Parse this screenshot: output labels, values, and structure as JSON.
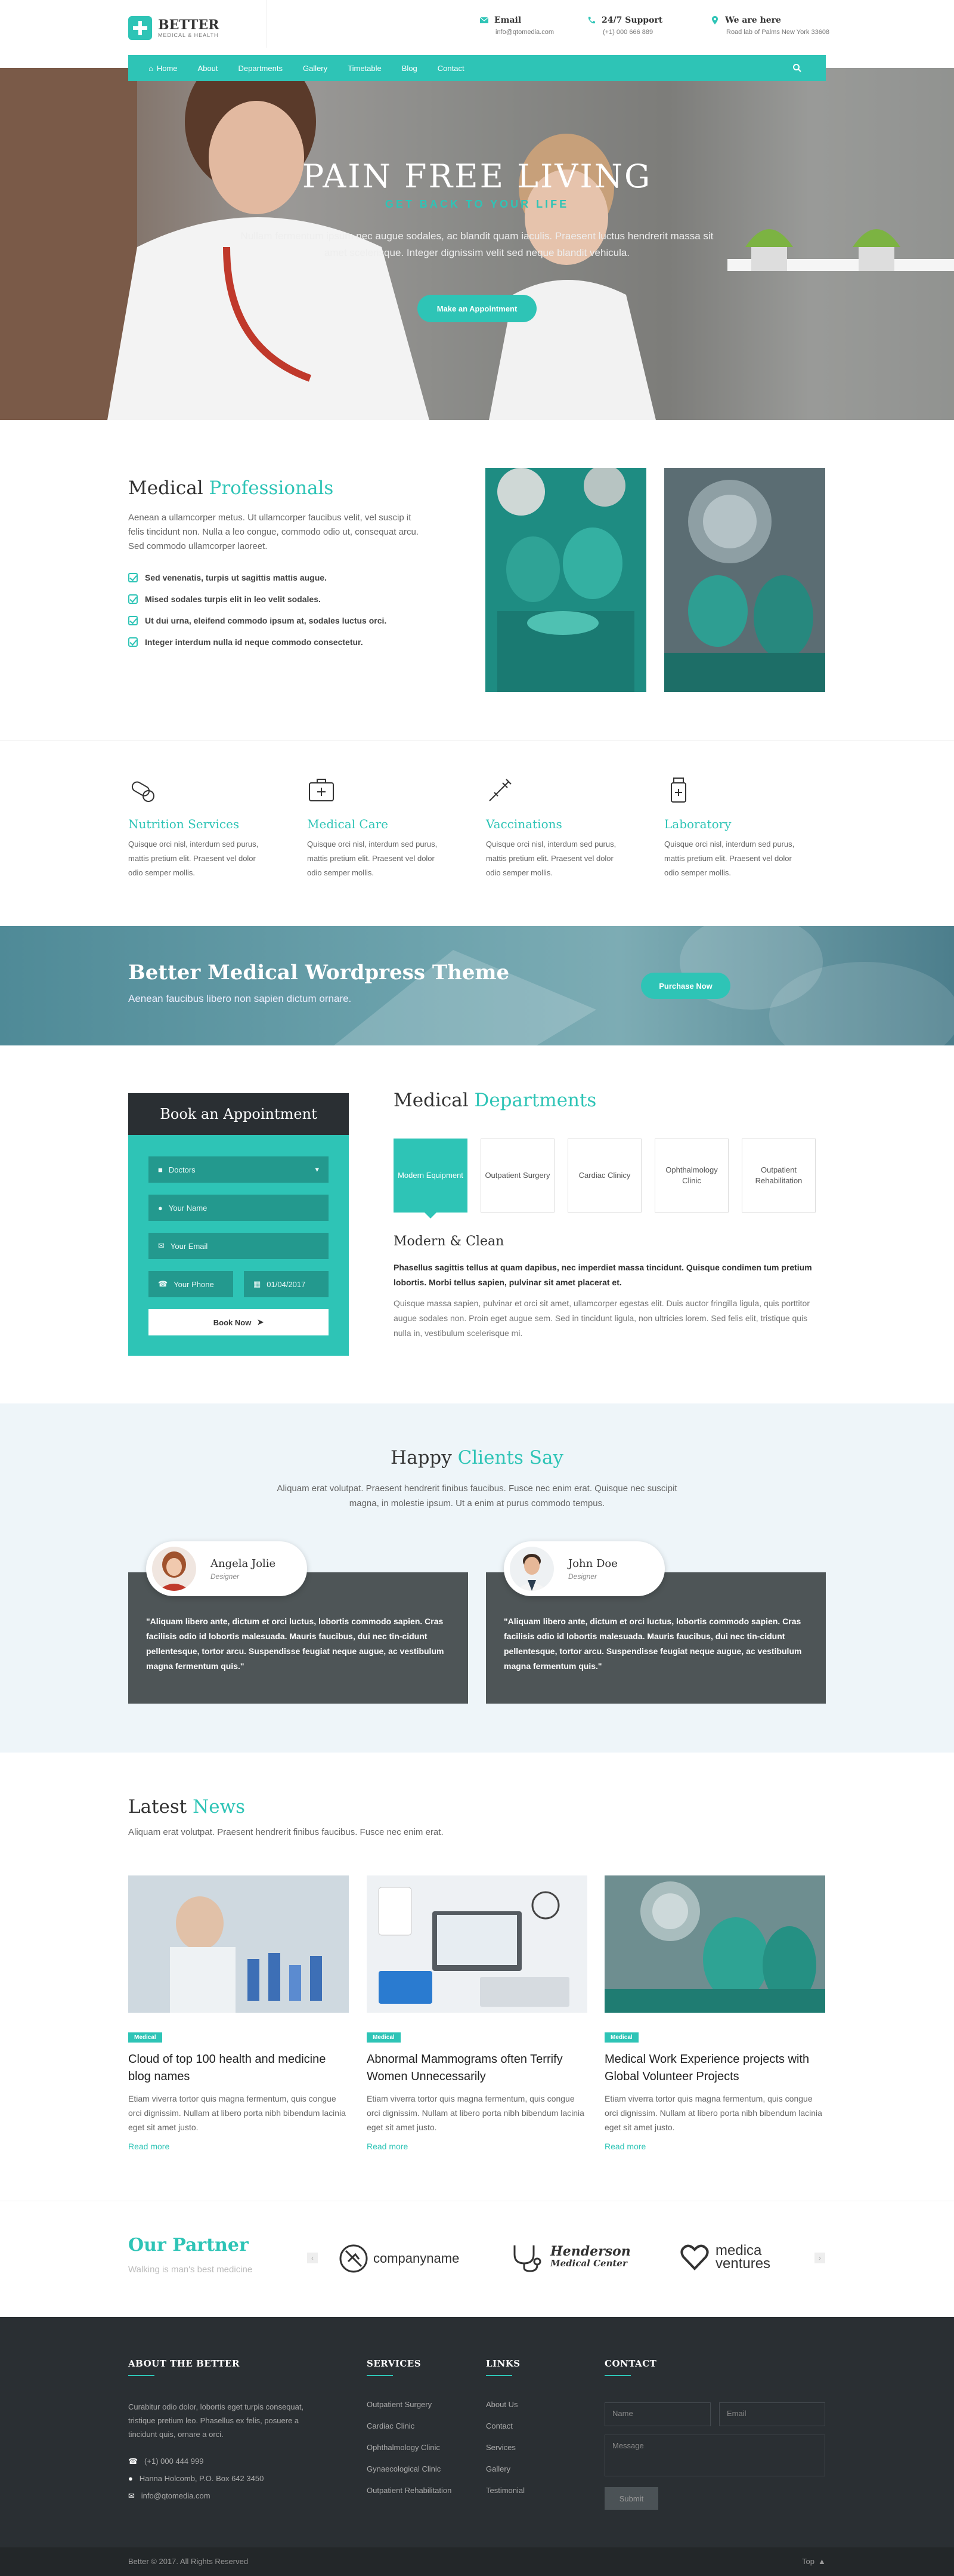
{
  "logo": {
    "name": "BETTER",
    "tagline": "MEDICAL & HEALTH"
  },
  "header": {
    "email": {
      "title": "Email",
      "value": "info@qtomedia.com"
    },
    "support": {
      "title": "24/7 Support",
      "value": "(+1) 000 666 889"
    },
    "location": {
      "title": "We are here",
      "value": "Road lab of Palms New York 33608"
    }
  },
  "nav": {
    "items": [
      "Home",
      "About",
      "Departments",
      "Gallery",
      "Timetable",
      "Blog",
      "Contact"
    ]
  },
  "hero": {
    "title": "PAIN FREE LIVING",
    "subtitle": "GET BACK TO YOUR LIFE",
    "text": "Nullam fermentum ipsum nec augue sodales, ac blandit quam iaculis. Praesent luctus hendrerit massa sit amet scelerisque. Integer dignissim velit sed neque blandit vehicula.",
    "button": "Make an Appointment"
  },
  "professionals": {
    "title_a": "Medical ",
    "title_b": "Professionals",
    "text": "Aenean a ullamcorper metus. Ut ullamcorper faucibus velit, vel suscip it felis tincidunt non. Nulla a leo congue, commodo odio ut, consequat arcu. Sed commodo ullamcorper laoreet.",
    "checks": [
      "Sed venenatis, turpis ut sagittis mattis augue.",
      "Mised sodales turpis elit in leo velit sodales.",
      "Ut dui urna, eleifend commodo ipsum at, sodales luctus orci.",
      "Integer interdum nulla id neque commodo consectetur."
    ]
  },
  "services": [
    {
      "icon": "pills-icon",
      "title": "Nutrition Services",
      "text": "Quisque orci nisl, interdum sed purus, mattis pretium elit. Praesent vel dolor odio semper mollis."
    },
    {
      "icon": "medical-kit-icon",
      "title": "Medical Care",
      "text": "Quisque orci nisl, interdum sed purus, mattis pretium elit. Praesent vel dolor odio semper mollis."
    },
    {
      "icon": "syringe-icon",
      "title": "Vaccinations",
      "text": "Quisque orci nisl, interdum sed purus, mattis pretium elit. Praesent vel dolor odio semper mollis."
    },
    {
      "icon": "lab-bottle-icon",
      "title": "Laboratory",
      "text": "Quisque orci nisl, interdum sed purus, mattis pretium elit. Praesent vel dolor odio semper mollis."
    }
  ],
  "banner": {
    "title": "Better Medical Wordpress Theme",
    "text": "Aenean faucibus libero non sapien dictum ornare.",
    "button": "Purchase Now"
  },
  "booking": {
    "title": "Book an Appointment",
    "doctor": "Doctors",
    "name": "Your Name",
    "email": "Your Email",
    "phone": "Your Phone",
    "date": "01/04/2017",
    "button": "Book Now"
  },
  "departments": {
    "title_a": "Medical ",
    "title_b": "Departments",
    "tabs": [
      "Modern Equipment",
      "Outpatient Surgery",
      "Cardiac Clinicy",
      "Ophthalmology Clinic",
      "Outpatient Rehabilitation"
    ],
    "heading": "Modern & Clean",
    "lead": "Phasellus sagittis tellus at quam dapibus, nec imperdiet massa tincidunt. Quisque condimen tum pretium lobortis. Morbi tellus sapien, pulvinar sit amet placerat et.",
    "text": "Quisque massa sapien, pulvinar et orci sit amet, ullamcorper egestas elit. Duis auctor fringilla ligula, quis porttitor augue sodales non. Proin eget augue sem. Sed in tincidunt ligula, non ultricies lorem. Sed felis elit, tristique quis nulla in, vestibulum scelerisque mi."
  },
  "testimonials": {
    "title_a": "Happy ",
    "title_b": "Clients Say",
    "intro": "Aliquam erat volutpat. Praesent hendrerit finibus faucibus. Fusce nec enim erat. Quisque nec suscipit magna, in molestie ipsum. Ut a enim at purus commodo tempus.",
    "items": [
      {
        "name": "Angela Jolie",
        "role": "Designer",
        "quote": "\"Aliquam libero ante, dictum et orci luctus, lobortis commodo sapien. Cras facilisis odio id lobortis malesuada. Mauris faucibus, dui nec tin-cidunt pellentesque, tortor arcu. Suspendisse feugiat neque augue, ac vestibulum magna fermentum quis.\""
      },
      {
        "name": "John Doe",
        "role": "Designer",
        "quote": "\"Aliquam libero ante, dictum et orci luctus, lobortis commodo sapien. Cras facilisis odio id lobortis malesuada. Mauris faucibus, dui nec tin-cidunt pellentesque, tortor arcu. Suspendisse feugiat neque augue, ac vestibulum magna fermentum quis.\""
      }
    ]
  },
  "news": {
    "title_a": "Latest ",
    "title_b": "News",
    "intro": "Aliquam erat volutpat. Praesent hendrerit finibus faucibus. Fusce nec enim erat.",
    "items": [
      {
        "badge": "Medical",
        "title": "Cloud of top 100 health and medicine blog names",
        "text": "Etiam viverra tortor quis magna fermentum, quis congue orci dignissim. Nullam at libero porta nibh bibendum lacinia eget sit amet justo.",
        "more": "Read more"
      },
      {
        "badge": "Medical",
        "title": "Abnormal Mammograms often Terrify Women Unnecessarily",
        "text": "Etiam viverra tortor quis magna fermentum, quis congue orci dignissim. Nullam at libero porta nibh bibendum lacinia eget sit amet justo.",
        "more": "Read more"
      },
      {
        "badge": "Medical",
        "title": "Medical Work Experience projects with Global Volunteer Projects",
        "text": "Etiam viverra tortor quis magna fermentum, quis congue orci dignissim. Nullam at libero porta nibh bibendum lacinia eget sit amet justo.",
        "more": "Read more"
      }
    ]
  },
  "partners": {
    "title": "Our Partner",
    "subtitle": "Walking is man's best medicine",
    "logos": [
      "companyname",
      "Henderson",
      "Medical Center",
      "medica",
      "ventures"
    ]
  },
  "footer": {
    "about": {
      "title": "ABOUT THE BETTER",
      "text": "Curabitur odio dolor, lobortis eget turpis consequat, tristique pretium leo. Phasellus ex felis, posuere a tincidunt quis, ornare a orci.",
      "phone": "(+1) 000 444 999",
      "address": "Hanna Holcomb, P.O. Box 642 3450",
      "email": "info@qtomedia.com"
    },
    "services": {
      "title": "SERVICES",
      "items": [
        "Outpatient Surgery",
        "Cardiac Clinic",
        "Ophthalmology Clinic",
        "Gynaecological Clinic",
        "Outpatient Rehabilitation"
      ]
    },
    "links": {
      "title": "LINKS",
      "items": [
        "About Us",
        "Contact",
        "Services",
        "Gallery",
        "Testimonial"
      ]
    },
    "contact": {
      "title": "CONTACT",
      "name": "Name",
      "email": "Email",
      "message": "Message",
      "submit": "Submit"
    },
    "copyright": "Better © 2017. All Rights Reserved",
    "top": "Top"
  },
  "colors": {
    "accent": "#2ec4b6",
    "dark": "#2a2f33",
    "card": "#4e5557"
  }
}
